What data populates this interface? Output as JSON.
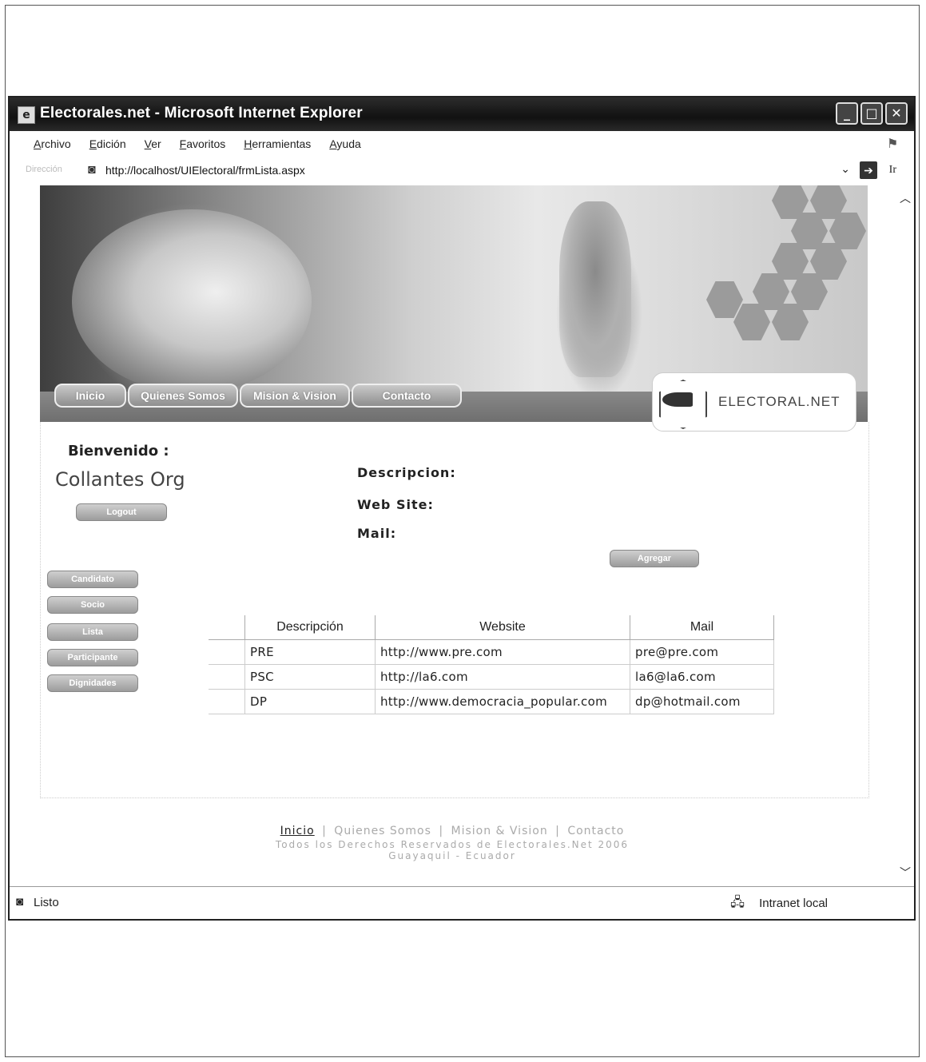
{
  "window": {
    "title": "Electorales.net - Microsoft Internet Explorer",
    "controls": {
      "minimize": "_",
      "maximize": "□",
      "close": "✕"
    }
  },
  "menubar": {
    "items": [
      "Archivo",
      "Edición",
      "Ver",
      "Favoritos",
      "Herramientas",
      "Ayuda"
    ]
  },
  "addressbar": {
    "label": "Dirección",
    "url": "http://localhost/UIElectoral/frmLista.aspx",
    "go_label": "Ir"
  },
  "site": {
    "nav": [
      "Inicio",
      "Quienes Somos",
      "Mision & Vision",
      "Contacto"
    ],
    "logo_text": "ELECTORAL.NET"
  },
  "sidebar": {
    "welcome": "Bienvenido :",
    "username": "Collantes Org",
    "logout": "Logout",
    "menu": [
      "Candidato",
      "Socio",
      "Lista",
      "Participante",
      "Dignidades"
    ]
  },
  "form": {
    "descripcion_label": "Descripcion:",
    "website_label": "Web Site:",
    "mail_label": "Mail:",
    "add_button": "Agregar"
  },
  "grid": {
    "headers": [
      "Descripción",
      "Website",
      "Mail"
    ],
    "rows": [
      [
        "PRE",
        "http://www.pre.com",
        "pre@pre.com"
      ],
      [
        "PSC",
        "http://la6.com",
        "la6@la6.com"
      ],
      [
        "DP",
        "http://www.democracia_popular.com",
        "dp@hotmail.com"
      ]
    ]
  },
  "footer": {
    "links": [
      "Inicio",
      "Quienes Somos",
      "Mision & Vision",
      "Contacto"
    ],
    "separator": "|",
    "rights": "Todos los Derechos Reservados de Electorales.Net 2006",
    "location": "Guayaquil - Ecuador"
  },
  "statusbar": {
    "status": "Listo",
    "zone": "Intranet local"
  }
}
